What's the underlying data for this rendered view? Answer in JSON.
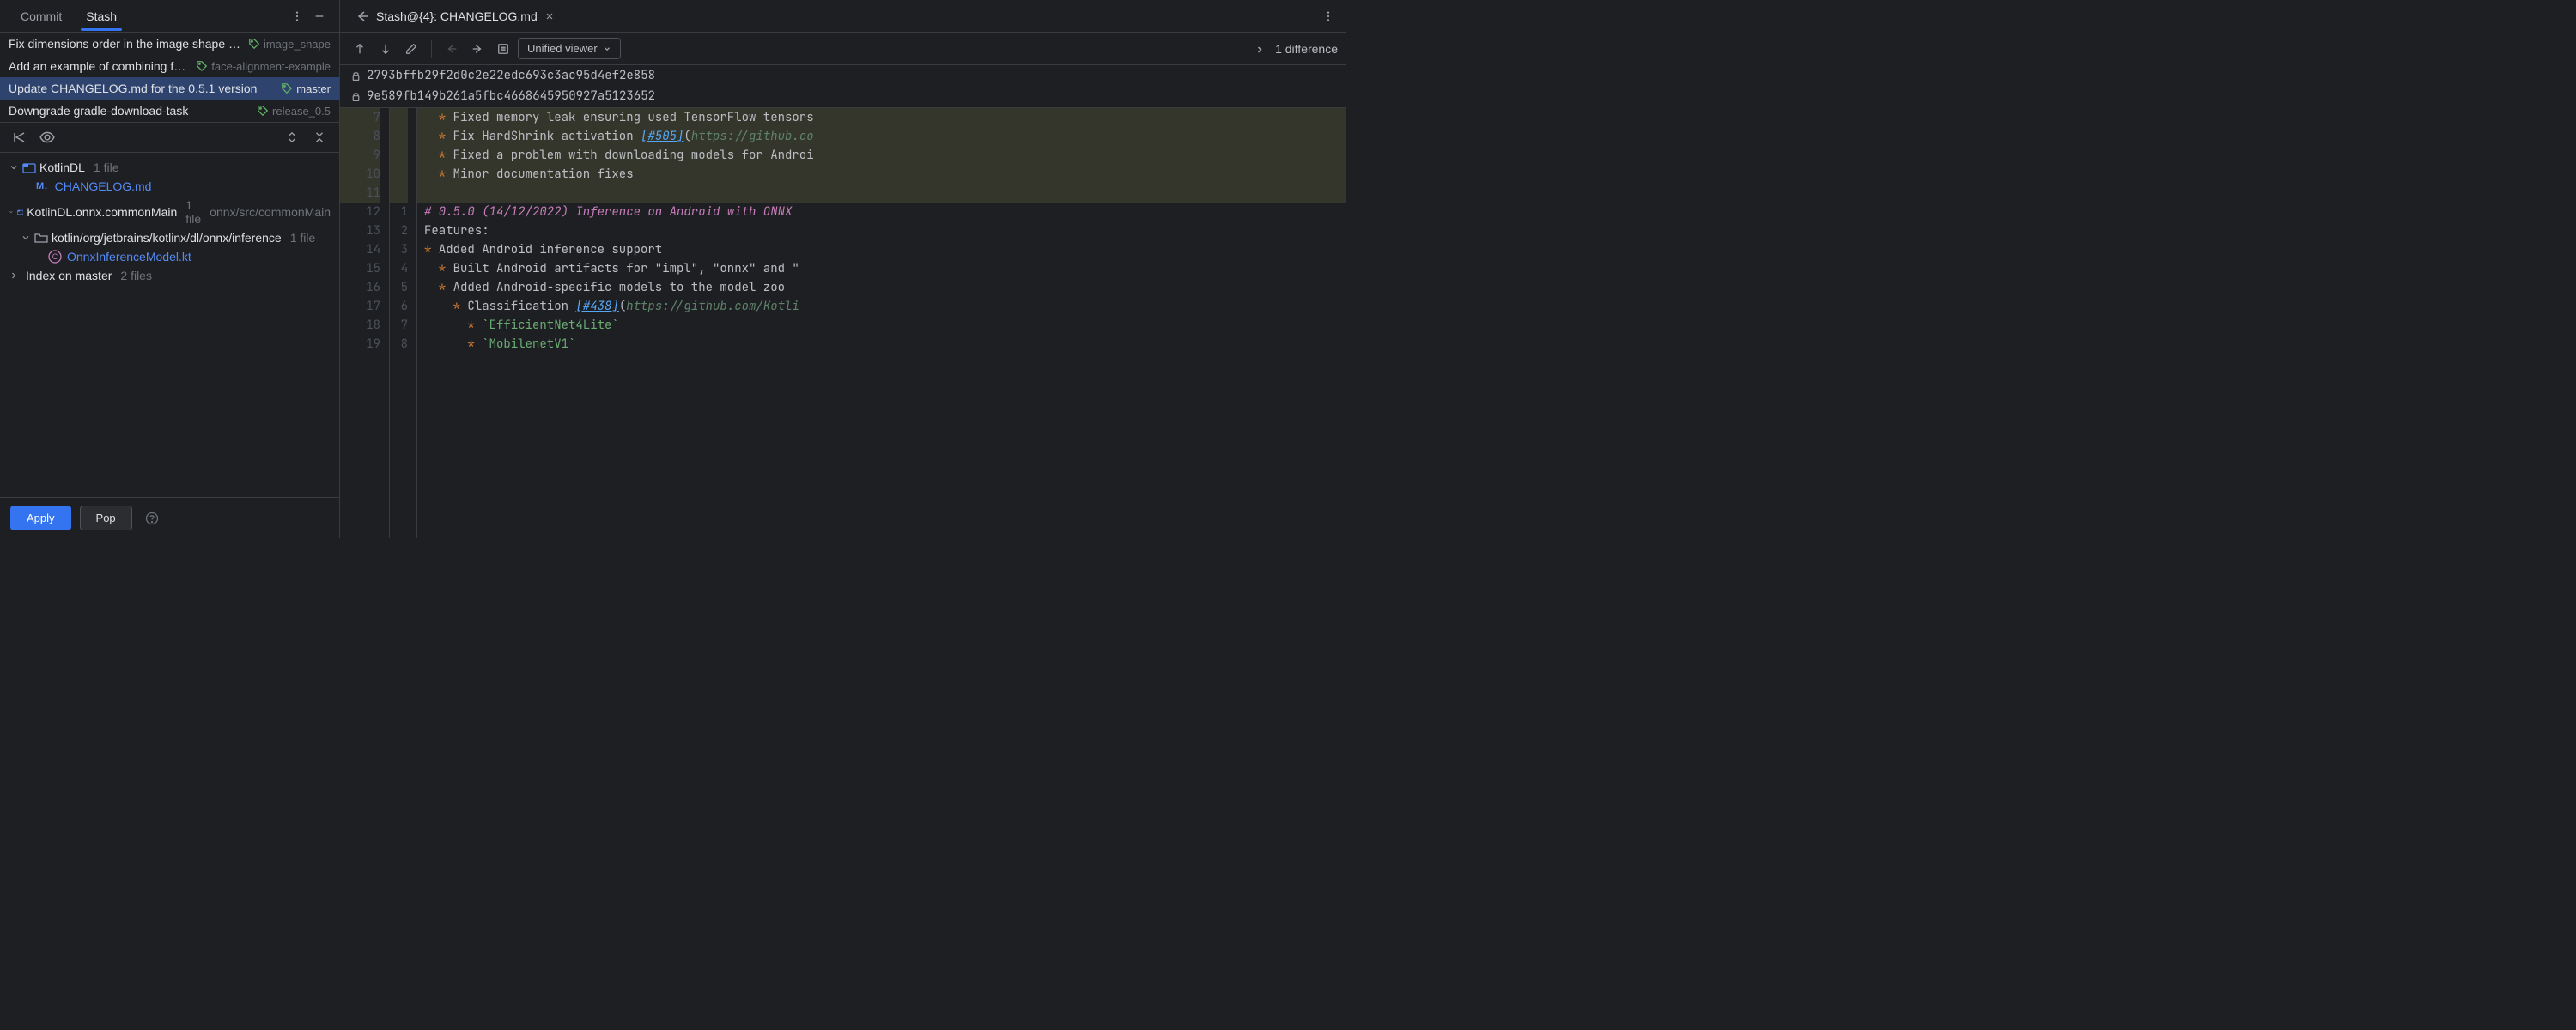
{
  "tabs": {
    "commit": "Commit",
    "stash": "Stash"
  },
  "commits": [
    {
      "msg": "Fix dimensions order in the image shape produced by prepro",
      "tag": "image_shape"
    },
    {
      "msg": "Add an example of combining face detection and ",
      "tag": "face-alignment-example"
    },
    {
      "msg": "Update CHANGELOG.md for the 0.5.1 version",
      "tag": "master"
    },
    {
      "msg": "Downgrade gradle-download-task",
      "tag": "release_0.5"
    }
  ],
  "tree": {
    "root1": "KotlinDL",
    "root1_meta": "1 file",
    "file1": "CHANGELOG.md",
    "root2": "KotlinDL.onnx.commonMain",
    "root2_meta": "1 file",
    "root2_path": "onnx/src/commonMain",
    "sub1": "kotlin/org/jetbrains/kotlinx/dl/onnx/inference",
    "sub1_meta": "1 file",
    "file2": "OnnxInferenceModel.kt",
    "root3": "Index on master",
    "root3_meta": "2 files"
  },
  "footer": {
    "apply": "Apply",
    "pop": "Pop"
  },
  "editor": {
    "tab_title": "Stash@{4}: CHANGELOG.md",
    "viewer": "Unified viewer",
    "diff_count": "1 difference",
    "hash1": "2793bffb29f2d0c2e22edc693c3ac95d4ef2e858",
    "hash2": "9e589fb149b261a5fbc4668645950927a5123652"
  },
  "code": {
    "gutter_left": [
      "7",
      "8",
      "9",
      "10",
      "11",
      "12",
      "13",
      "14",
      "15",
      "16",
      "17",
      "18",
      "19"
    ],
    "gutter_right": [
      "",
      "",
      "",
      "",
      "",
      "1",
      "2",
      "3",
      "4",
      "5",
      "6",
      "7",
      "8"
    ],
    "l1_a": "  * ",
    "l1_b": "Fixed memory leak ensuring used TensorFlow tensors",
    "l2_a": "  * ",
    "l2_b": "Fix HardShrink activation ",
    "l2_c": "[#505]",
    "l2_d": "(",
    "l2_e": "https://github.co",
    "l3_a": "  * ",
    "l3_b": "Fixed a problem with downloading models for Androi",
    "l4_a": "  * ",
    "l4_b": "Minor documentation fixes",
    "l6": "# 0.5.0 (14/12/2022) Inference on Android with ONNX",
    "l7": "Features:",
    "l8_a": "* ",
    "l8_b": "Added Android inference support",
    "l9_a": "  * ",
    "l9_b": "Built Android artifacts for \"impl\", \"onnx\" and \"",
    "l10_a": "  * ",
    "l10_b": "Added Android-specific models to the model zoo",
    "l11_a": "    * ",
    "l11_b": "Classification ",
    "l11_c": "[#438]",
    "l11_d": "(",
    "l11_e": "https://github.com/Kotli",
    "l12_a": "      * ",
    "l12_b": "`EfficientNet4Lite`",
    "l13_a": "      * ",
    "l13_b": "`MobilenetV1`"
  }
}
